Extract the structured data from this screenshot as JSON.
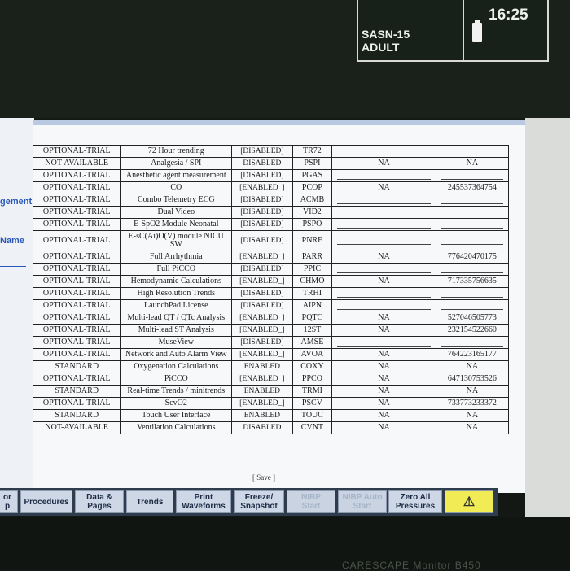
{
  "status": {
    "line1": "SASN-15",
    "line2": "ADULT",
    "time": "16:25"
  },
  "left_panel": {
    "fragment1": "gement",
    "fragment2": "Name"
  },
  "rows": [
    {
      "status": "OPTIONAL-TRIAL",
      "feature": "72 Hour trending",
      "state": "[DISABLED]",
      "code": "TR72",
      "na": "",
      "number": ""
    },
    {
      "status": "NOT-AVAILABLE",
      "feature": "Analgesia / SPI",
      "state": "DISABLED",
      "code": "PSPI",
      "na": "NA",
      "number": "NA"
    },
    {
      "status": "OPTIONAL-TRIAL",
      "feature": "Anesthetic agent measurement",
      "state": "[DISABLED]",
      "code": "PGAS",
      "na": "",
      "number": ""
    },
    {
      "status": "OPTIONAL-TRIAL",
      "feature": "CO",
      "state": "[ENABLED_]",
      "code": "PCOP",
      "na": "NA",
      "number": "245537364754"
    },
    {
      "status": "OPTIONAL-TRIAL",
      "feature": "Combo Telemetry ECG",
      "state": "[DISABLED]",
      "code": "ACMB",
      "na": "",
      "number": ""
    },
    {
      "status": "OPTIONAL-TRIAL",
      "feature": "Dual Video",
      "state": "[DISABLED]",
      "code": "VID2",
      "na": "",
      "number": ""
    },
    {
      "status": "OPTIONAL-TRIAL",
      "feature": "E-SpO2 Module Neonatal",
      "state": "[DISABLED]",
      "code": "PSPO",
      "na": "",
      "number": ""
    },
    {
      "status": "OPTIONAL-TRIAL",
      "feature": "E-sC(Ai)O(V) module NICU SW",
      "state": "[DISABLED]",
      "code": "PNRE",
      "na": "",
      "number": ""
    },
    {
      "status": "OPTIONAL-TRIAL",
      "feature": "Full Arrhythmia",
      "state": "[ENABLED_]",
      "code": "PARR",
      "na": "NA",
      "number": "776420470175"
    },
    {
      "status": "OPTIONAL-TRIAL",
      "feature": "Full PiCCO",
      "state": "[DISABLED]",
      "code": "PPIC",
      "na": "",
      "number": ""
    },
    {
      "status": "OPTIONAL-TRIAL",
      "feature": "Hemodynamic Calculations",
      "state": "[ENABLED_]",
      "code": "CHMO",
      "na": "NA",
      "number": "717335756635"
    },
    {
      "status": "OPTIONAL-TRIAL",
      "feature": "High Resolution Trends",
      "state": "[DISABLED]",
      "code": "TRHI",
      "na": "",
      "number": ""
    },
    {
      "status": "OPTIONAL-TRIAL",
      "feature": "LaunchPad License",
      "state": "[DISABLED]",
      "code": "AIPN",
      "na": "",
      "number": ""
    },
    {
      "status": "OPTIONAL-TRIAL",
      "feature": "Multi-lead QT / QTc Analysis",
      "state": "[ENABLED_]",
      "code": "PQTC",
      "na": "NA",
      "number": "527046505773"
    },
    {
      "status": "OPTIONAL-TRIAL",
      "feature": "Multi-lead ST Analysis",
      "state": "[ENABLED_]",
      "code": "12ST",
      "na": "NA",
      "number": "232154522660"
    },
    {
      "status": "OPTIONAL-TRIAL",
      "feature": "MuseView",
      "state": "[DISABLED]",
      "code": "AMSE",
      "na": "",
      "number": ""
    },
    {
      "status": "OPTIONAL-TRIAL",
      "feature": "Network and Auto Alarm View",
      "state": "[ENABLED_]",
      "code": "AVOA",
      "na": "NA",
      "number": "764223165177"
    },
    {
      "status": "STANDARD",
      "feature": "Oxygenation Calculations",
      "state": "ENABLED",
      "code": "COXY",
      "na": "NA",
      "number": "NA"
    },
    {
      "status": "OPTIONAL-TRIAL",
      "feature": "PiCCO",
      "state": "[ENABLED_]",
      "code": "PPCO",
      "na": "NA",
      "number": "647130753526"
    },
    {
      "status": "STANDARD",
      "feature": "Real-time Trends / minitrends",
      "state": "ENABLED",
      "code": "TRMI",
      "na": "NA",
      "number": "NA"
    },
    {
      "status": "OPTIONAL-TRIAL",
      "feature": "ScvO2",
      "state": "[ENABLED_]",
      "code": "PSCV",
      "na": "NA",
      "number": "733773233372"
    },
    {
      "status": "STANDARD",
      "feature": "Touch User Interface",
      "state": "ENABLED",
      "code": "TOUC",
      "na": "NA",
      "number": "NA"
    },
    {
      "status": "NOT-AVAILABLE",
      "feature": "Ventilation Calculations",
      "state": "DISABLED",
      "code": "CVNT",
      "na": "NA",
      "number": "NA"
    }
  ],
  "save_label": "[ Save ]",
  "softkeys": [
    {
      "label": "or\np",
      "enabled": true
    },
    {
      "label": "Procedures",
      "enabled": true
    },
    {
      "label": "Data &\nPages",
      "enabled": true
    },
    {
      "label": "Trends",
      "enabled": true
    },
    {
      "label": "Print\nWaveforms",
      "enabled": true
    },
    {
      "label": "Freeze/\nSnapshot",
      "enabled": true
    },
    {
      "label": "NIBP\nStart",
      "enabled": false
    },
    {
      "label": "NIBP Auto\nStart",
      "enabled": false
    },
    {
      "label": "Zero All\nPressures",
      "enabled": true
    },
    {
      "label": "⚠",
      "enabled": true
    }
  ],
  "brand": "CARESCAPE Monitor B450"
}
